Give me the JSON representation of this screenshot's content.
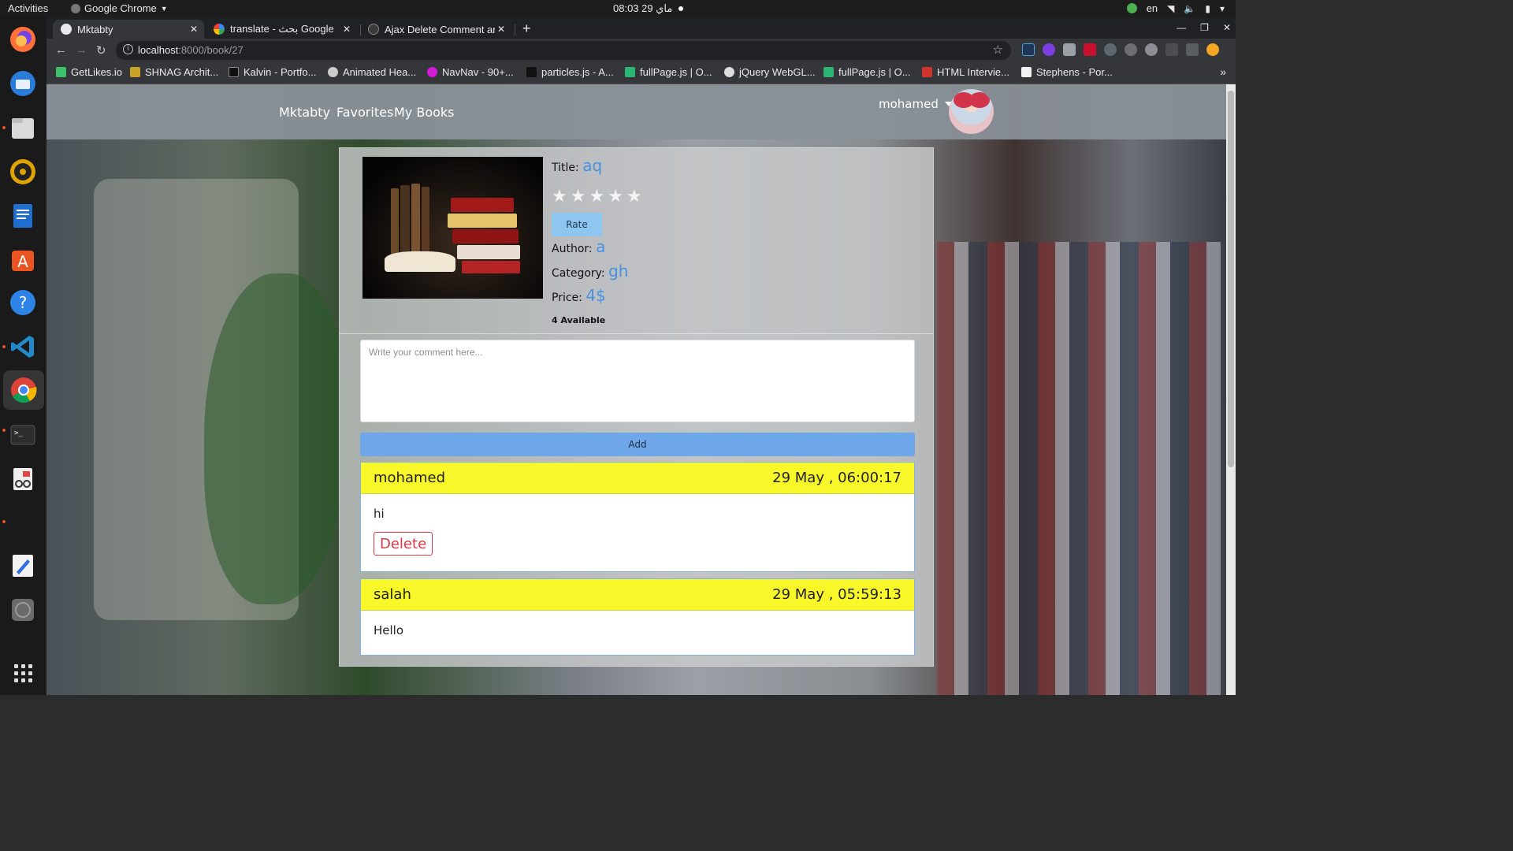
{
  "system": {
    "activities": "Activities",
    "app_name": "Google Chrome",
    "clock": "08:03  29 ماي",
    "lang": "en"
  },
  "tabs": [
    {
      "title": "Mktabty",
      "active": true
    },
    {
      "title": "translate - بحث Google",
      "active": false
    },
    {
      "title": "Ajax Delete Comment and",
      "active": false
    }
  ],
  "address": {
    "host": "localhost",
    "path": ":8000/book/27"
  },
  "bookmarks": [
    {
      "label": "GetLikes.io",
      "color": "#3ec16b"
    },
    {
      "label": "SHNAG Archit...",
      "color": "#c9a227"
    },
    {
      "label": "Kalvin - Portfo...",
      "color": "#111111"
    },
    {
      "label": "Animated Hea...",
      "color": "#cccccc"
    },
    {
      "label": "NavNav - 90+...",
      "color": "#d21bd6"
    },
    {
      "label": "particles.js - A...",
      "color": "#111111"
    },
    {
      "label": "fullPage.js | O...",
      "color": "#2bb673"
    },
    {
      "label": "jQuery WebGL...",
      "color": "#dddddd"
    },
    {
      "label": "fullPage.js | O...",
      "color": "#2bb673"
    },
    {
      "label": "HTML Intervie...",
      "color": "#d0342c"
    },
    {
      "label": "Stephens - Por...",
      "color": "#f2f2f2"
    }
  ],
  "navbar": {
    "brand": "Mktabty",
    "links": [
      "Favorites",
      "My Books"
    ],
    "user": "mohamed"
  },
  "book": {
    "title_label": "Title:",
    "title": "aq",
    "rating": 0,
    "max_rating": 5,
    "rate_button": "Rate",
    "author_label": "Author:",
    "author": "a",
    "category_label": "Category:",
    "category": "gh",
    "price_label": "Price:",
    "price": "4$",
    "available": "4 Available"
  },
  "comment_form": {
    "placeholder": "Write your comment here...",
    "submit": "Add"
  },
  "comments": [
    {
      "author": "mohamed",
      "date": "29 May , 06:00:17",
      "text": "hi",
      "delete_label": "Delete"
    },
    {
      "author": "salah",
      "date": "29 May , 05:59:13",
      "text": "Hello"
    }
  ],
  "colors": {
    "accent": "#4a90e2",
    "comment_header": "#f7f72a",
    "delete": "#dc3545",
    "add_button": "#6ea6ea"
  }
}
